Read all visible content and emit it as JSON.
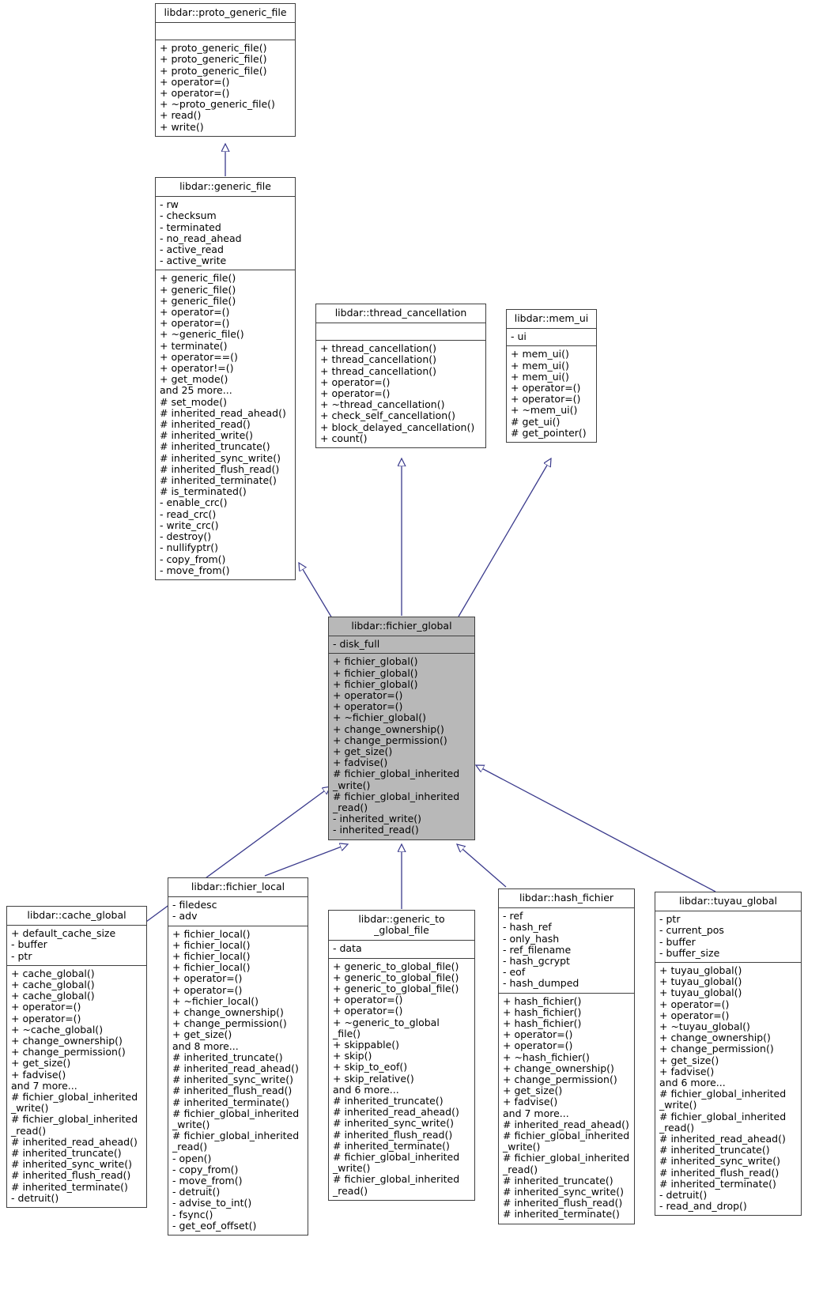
{
  "diagram": {
    "kind": "uml-class-inheritance-diagram",
    "edge_color": "#3a3a8c",
    "highlight_color": "#b8b8b8",
    "border_color": "#404040",
    "background_color": "#ffffff"
  },
  "classes": [
    {
      "id": "proto_generic_file",
      "name": "libdar::proto_generic_file",
      "attributes": [],
      "operations": [
        "+ proto_generic_file()",
        "+ proto_generic_file()",
        "+ proto_generic_file()",
        "+ operator=()",
        "+ operator=()",
        "+ ~proto_generic_file()",
        "+ read()",
        "+ write()"
      ]
    },
    {
      "id": "generic_file",
      "name": "libdar::generic_file",
      "attributes": [
        "- rw",
        "- checksum",
        "- terminated",
        "- no_read_ahead",
        "- active_read",
        "- active_write"
      ],
      "operations": [
        "+ generic_file()",
        "+ generic_file()",
        "+ generic_file()",
        "+ operator=()",
        "+ operator=()",
        "+ ~generic_file()",
        "+ terminate()",
        "+ operator==()",
        "+ operator!=()",
        "+ get_mode()",
        "and 25 more...",
        "# set_mode()",
        "# inherited_read_ahead()",
        "# inherited_read()",
        "# inherited_write()",
        "# inherited_truncate()",
        "# inherited_sync_write()",
        "# inherited_flush_read()",
        "# inherited_terminate()",
        "# is_terminated()",
        "- enable_crc()",
        "- read_crc()",
        "- write_crc()",
        "- destroy()",
        "- nullifyptr()",
        "- copy_from()",
        "- move_from()"
      ]
    },
    {
      "id": "thread_cancellation",
      "name": "libdar::thread_cancellation",
      "attributes": [],
      "operations": [
        "+ thread_cancellation()",
        "+ thread_cancellation()",
        "+ thread_cancellation()",
        "+ operator=()",
        "+ operator=()",
        "+ ~thread_cancellation()",
        "+ check_self_cancellation()",
        "+ block_delayed_cancellation()",
        "+ count()"
      ]
    },
    {
      "id": "mem_ui",
      "name": "libdar::mem_ui",
      "attributes": [
        "- ui"
      ],
      "operations": [
        "+ mem_ui()",
        "+ mem_ui()",
        "+ mem_ui()",
        "+ operator=()",
        "+ operator=()",
        "+ ~mem_ui()",
        "# get_ui()",
        "# get_pointer()"
      ]
    },
    {
      "id": "fichier_global",
      "name": "libdar::fichier_global",
      "highlighted": true,
      "attributes": [
        "- disk_full"
      ],
      "operations": [
        "+ fichier_global()",
        "+ fichier_global()",
        "+ fichier_global()",
        "+ operator=()",
        "+ operator=()",
        "+ ~fichier_global()",
        "+ change_ownership()",
        "+ change_permission()",
        "+ get_size()",
        "+ fadvise()",
        "# fichier_global_inherited\n_write()",
        "# fichier_global_inherited\n_read()",
        "- inherited_write()",
        "- inherited_read()"
      ]
    },
    {
      "id": "cache_global",
      "name": "libdar::cache_global",
      "attributes": [
        "+ default_cache_size",
        "- buffer",
        "- ptr"
      ],
      "operations": [
        "+ cache_global()",
        "+ cache_global()",
        "+ cache_global()",
        "+ operator=()",
        "+ operator=()",
        "+ ~cache_global()",
        "+ change_ownership()",
        "+ change_permission()",
        "+ get_size()",
        "+ fadvise()",
        "and 7 more...",
        "# fichier_global_inherited\n_write()",
        "# fichier_global_inherited\n_read()",
        "# inherited_read_ahead()",
        "# inherited_truncate()",
        "# inherited_sync_write()",
        "# inherited_flush_read()",
        "# inherited_terminate()",
        "- detruit()"
      ]
    },
    {
      "id": "fichier_local",
      "name": "libdar::fichier_local",
      "attributes": [
        "- filedesc",
        "- adv"
      ],
      "operations": [
        "+ fichier_local()",
        "+ fichier_local()",
        "+ fichier_local()",
        "+ fichier_local()",
        "+ operator=()",
        "+ operator=()",
        "+ ~fichier_local()",
        "+ change_ownership()",
        "+ change_permission()",
        "+ get_size()",
        "and 8 more...",
        "# inherited_truncate()",
        "# inherited_read_ahead()",
        "# inherited_sync_write()",
        "# inherited_flush_read()",
        "# inherited_terminate()",
        "# fichier_global_inherited\n_write()",
        "# fichier_global_inherited\n_read()",
        "- open()",
        "- copy_from()",
        "- move_from()",
        "- detruit()",
        "- advise_to_int()",
        "- fsync()",
        "- get_eof_offset()"
      ]
    },
    {
      "id": "generic_to_global_file",
      "name": "libdar::generic_to\n_global_file",
      "attributes": [
        "- data"
      ],
      "operations": [
        "+ generic_to_global_file()",
        "+ generic_to_global_file()",
        "+ generic_to_global_file()",
        "+ operator=()",
        "+ operator=()",
        "+ ~generic_to_global\n_file()",
        "+ skippable()",
        "+ skip()",
        "+ skip_to_eof()",
        "+ skip_relative()",
        "and 6 more...",
        "# inherited_truncate()",
        "# inherited_read_ahead()",
        "# inherited_sync_write()",
        "# inherited_flush_read()",
        "# inherited_terminate()",
        "# fichier_global_inherited\n_write()",
        "# fichier_global_inherited\n_read()"
      ]
    },
    {
      "id": "hash_fichier",
      "name": "libdar::hash_fichier",
      "attributes": [
        "- ref",
        "- hash_ref",
        "- only_hash",
        "- ref_filename",
        "- hash_gcrypt",
        "- eof",
        "- hash_dumped"
      ],
      "operations": [
        "+ hash_fichier()",
        "+ hash_fichier()",
        "+ hash_fichier()",
        "+ operator=()",
        "+ operator=()",
        "+ ~hash_fichier()",
        "+ change_ownership()",
        "+ change_permission()",
        "+ get_size()",
        "+ fadvise()",
        "and 7 more...",
        "# inherited_read_ahead()",
        "# fichier_global_inherited\n_write()",
        "# fichier_global_inherited\n_read()",
        "# inherited_truncate()",
        "# inherited_sync_write()",
        "# inherited_flush_read()",
        "# inherited_terminate()"
      ]
    },
    {
      "id": "tuyau_global",
      "name": "libdar::tuyau_global",
      "attributes": [
        "- ptr",
        "- current_pos",
        "- buffer",
        "- buffer_size"
      ],
      "operations": [
        "+ tuyau_global()",
        "+ tuyau_global()",
        "+ tuyau_global()",
        "+ operator=()",
        "+ operator=()",
        "+ ~tuyau_global()",
        "+ change_ownership()",
        "+ change_permission()",
        "+ get_size()",
        "+ fadvise()",
        "and 6 more...",
        "# fichier_global_inherited\n_write()",
        "# fichier_global_inherited\n_read()",
        "# inherited_read_ahead()",
        "# inherited_truncate()",
        "# inherited_sync_write()",
        "# inherited_flush_read()",
        "# inherited_terminate()",
        "- detruit()",
        "- read_and_drop()"
      ]
    }
  ],
  "inheritance_edges": [
    {
      "from": "generic_file",
      "to": "proto_generic_file"
    },
    {
      "from": "fichier_global",
      "to": "generic_file"
    },
    {
      "from": "fichier_global",
      "to": "thread_cancellation"
    },
    {
      "from": "fichier_global",
      "to": "mem_ui"
    },
    {
      "from": "cache_global",
      "to": "fichier_global"
    },
    {
      "from": "fichier_local",
      "to": "fichier_global"
    },
    {
      "from": "generic_to_global_file",
      "to": "fichier_global"
    },
    {
      "from": "hash_fichier",
      "to": "fichier_global"
    },
    {
      "from": "tuyau_global",
      "to": "fichier_global"
    }
  ]
}
